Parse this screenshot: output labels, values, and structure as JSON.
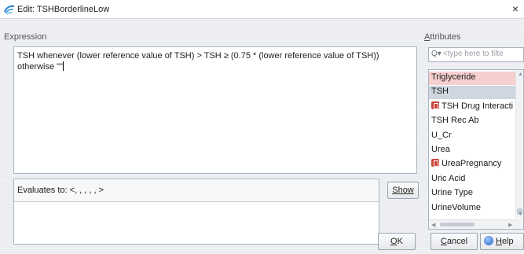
{
  "window": {
    "title": "Edit: TSHBorderlineLow",
    "close_glyph": "×"
  },
  "expression": {
    "label": "Expression",
    "text": "TSH whenever (lower reference value of TSH) > TSH ≥ (0.75 * (lower reference value of TSH))\notherwise \"\""
  },
  "evaluation": {
    "text": "Evaluates to: <, , , , , >",
    "show_label": "Show"
  },
  "attributes": {
    "label_prefix": "",
    "label_accel": "A",
    "label_rest": "ttributes",
    "search_placeholder": "<type here to filte",
    "items": [
      {
        "label": "Triglyceride",
        "style": "pink",
        "icon": ""
      },
      {
        "label": "TSH",
        "style": "grey",
        "icon": ""
      },
      {
        "label": "TSH Drug Interacti",
        "style": "",
        "icon": "red-list-icon"
      },
      {
        "label": "TSH Rec Ab",
        "style": "",
        "icon": ""
      },
      {
        "label": "U_Cr",
        "style": "",
        "icon": ""
      },
      {
        "label": "Urea",
        "style": "",
        "icon": ""
      },
      {
        "label": "UreaPregnancy",
        "style": "",
        "icon": "red-list-icon"
      },
      {
        "label": "Uric Acid",
        "style": "",
        "icon": ""
      },
      {
        "label": "Urine Type",
        "style": "",
        "icon": ""
      },
      {
        "label": "UrineVolume",
        "style": "",
        "icon": ""
      }
    ]
  },
  "buttons": {
    "ok_accel": "O",
    "ok_rest": "K",
    "cancel_accel": "C",
    "cancel_rest": "ancel",
    "help_accel": "H",
    "help_rest": "elp"
  },
  "colors": {
    "highlight_pink": "#f6cfcf",
    "selected_grey": "#cfd6df",
    "icon_red": "#c9443c"
  }
}
